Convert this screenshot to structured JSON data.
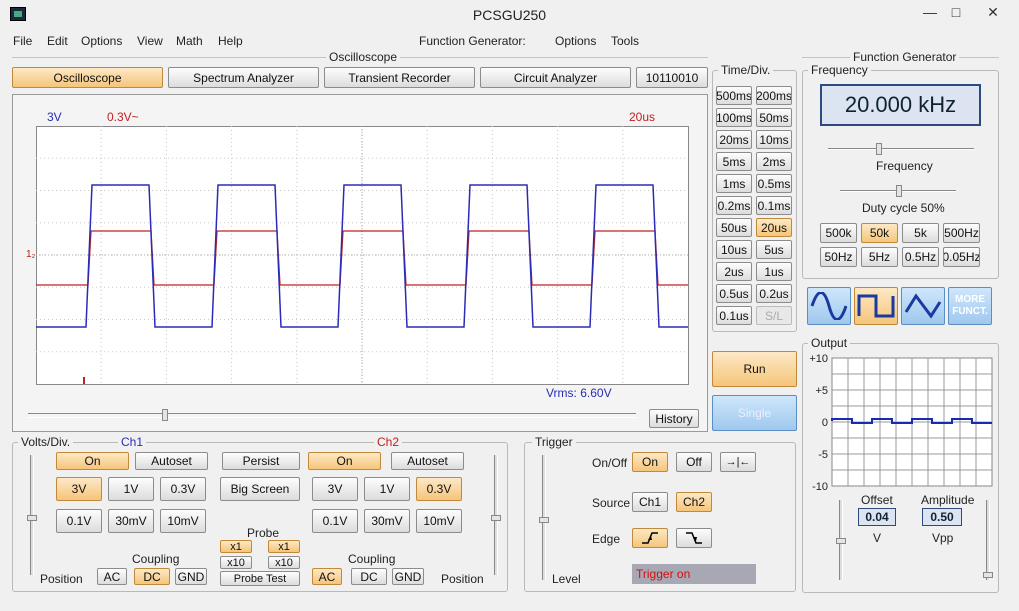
{
  "window": {
    "title": "PCSGU250",
    "minimize": "—",
    "maximize": "□",
    "close": "✕"
  },
  "menu": [
    "File",
    "Edit",
    "Options",
    "View",
    "Math",
    "Help"
  ],
  "menu2": [
    "Function Generator:",
    "Options",
    "Tools"
  ],
  "osc": {
    "label": "Oscilloscope",
    "modes": [
      "Oscilloscope",
      "Spectrum Analyzer",
      "Transient Recorder",
      "Circuit Analyzer",
      "10110010"
    ],
    "ch1_volt": "3V",
    "ch2_volt": "0.3V~",
    "time": "20us",
    "vrms": "Vrms: 6.60V",
    "marker": "1₂",
    "history": "History",
    "ch1_color": "#2b2bb5",
    "ch2_color": "#c02020"
  },
  "timediv": {
    "label": "Time/Div.",
    "buttons": [
      "500ms",
      "200ms",
      "100ms",
      "50ms",
      "20ms",
      "10ms",
      "5ms",
      "2ms",
      "1ms",
      "0.5ms",
      "0.2ms",
      "0.1ms",
      "50us",
      "20us",
      "10us",
      "5us",
      "2us",
      "1us",
      "0.5us",
      "0.2us",
      "0.1us",
      "S/L"
    ],
    "selected": "20us",
    "disabled": "S/L"
  },
  "run": {
    "run": "Run",
    "single": "Single"
  },
  "volts": {
    "label": "Volts/Div.",
    "ch1": "Ch1",
    "ch2": "Ch2",
    "on": "On",
    "autoset": "Autoset",
    "persist": "Persist",
    "big_screen": "Big Screen",
    "ch1_volts": [
      "3V",
      "1V",
      "0.3V",
      "0.1V",
      "30mV",
      "10mV"
    ],
    "ch2_volts": [
      "3V",
      "1V",
      "0.3V",
      "0.1V",
      "30mV",
      "10mV"
    ],
    "ch1_sel": "3V",
    "ch2_sel": "0.3V",
    "probe": "Probe",
    "x1": "x1",
    "x10": "x10",
    "probe_test": "Probe Test",
    "coupling": "Coupling",
    "ac": "AC",
    "dc": "DC",
    "gnd": "GND",
    "position": "Position"
  },
  "trigger": {
    "label": "Trigger",
    "onoff": "On/Off",
    "on": "On",
    "off": "Off",
    "source": "Source",
    "ch1": "Ch1",
    "ch2": "Ch2",
    "edge": "Edge",
    "level": "Level",
    "status": "Trigger on",
    "expand": "→|←"
  },
  "fg": {
    "label": "Function Generator",
    "freq_label": "Frequency",
    "freq_value": "20.000 kHz",
    "freq_slider": "Frequency",
    "duty": "Duty cycle 50%",
    "ranges": [
      "500k",
      "50k",
      "5k",
      "500Hz",
      "50Hz",
      "5Hz",
      "0.5Hz",
      "0.05Hz"
    ],
    "range_sel": "50k",
    "more": "MORE\nFUNCT.",
    "output": "Output",
    "yticks": [
      "+10",
      "+5",
      "0",
      "-5",
      "-10"
    ],
    "offset_label": "Offset",
    "offset": "0.04",
    "offset_unit": "V",
    "amp_label": "Amplitude",
    "amp": "0.50",
    "amp_unit": "Vpp"
  }
}
